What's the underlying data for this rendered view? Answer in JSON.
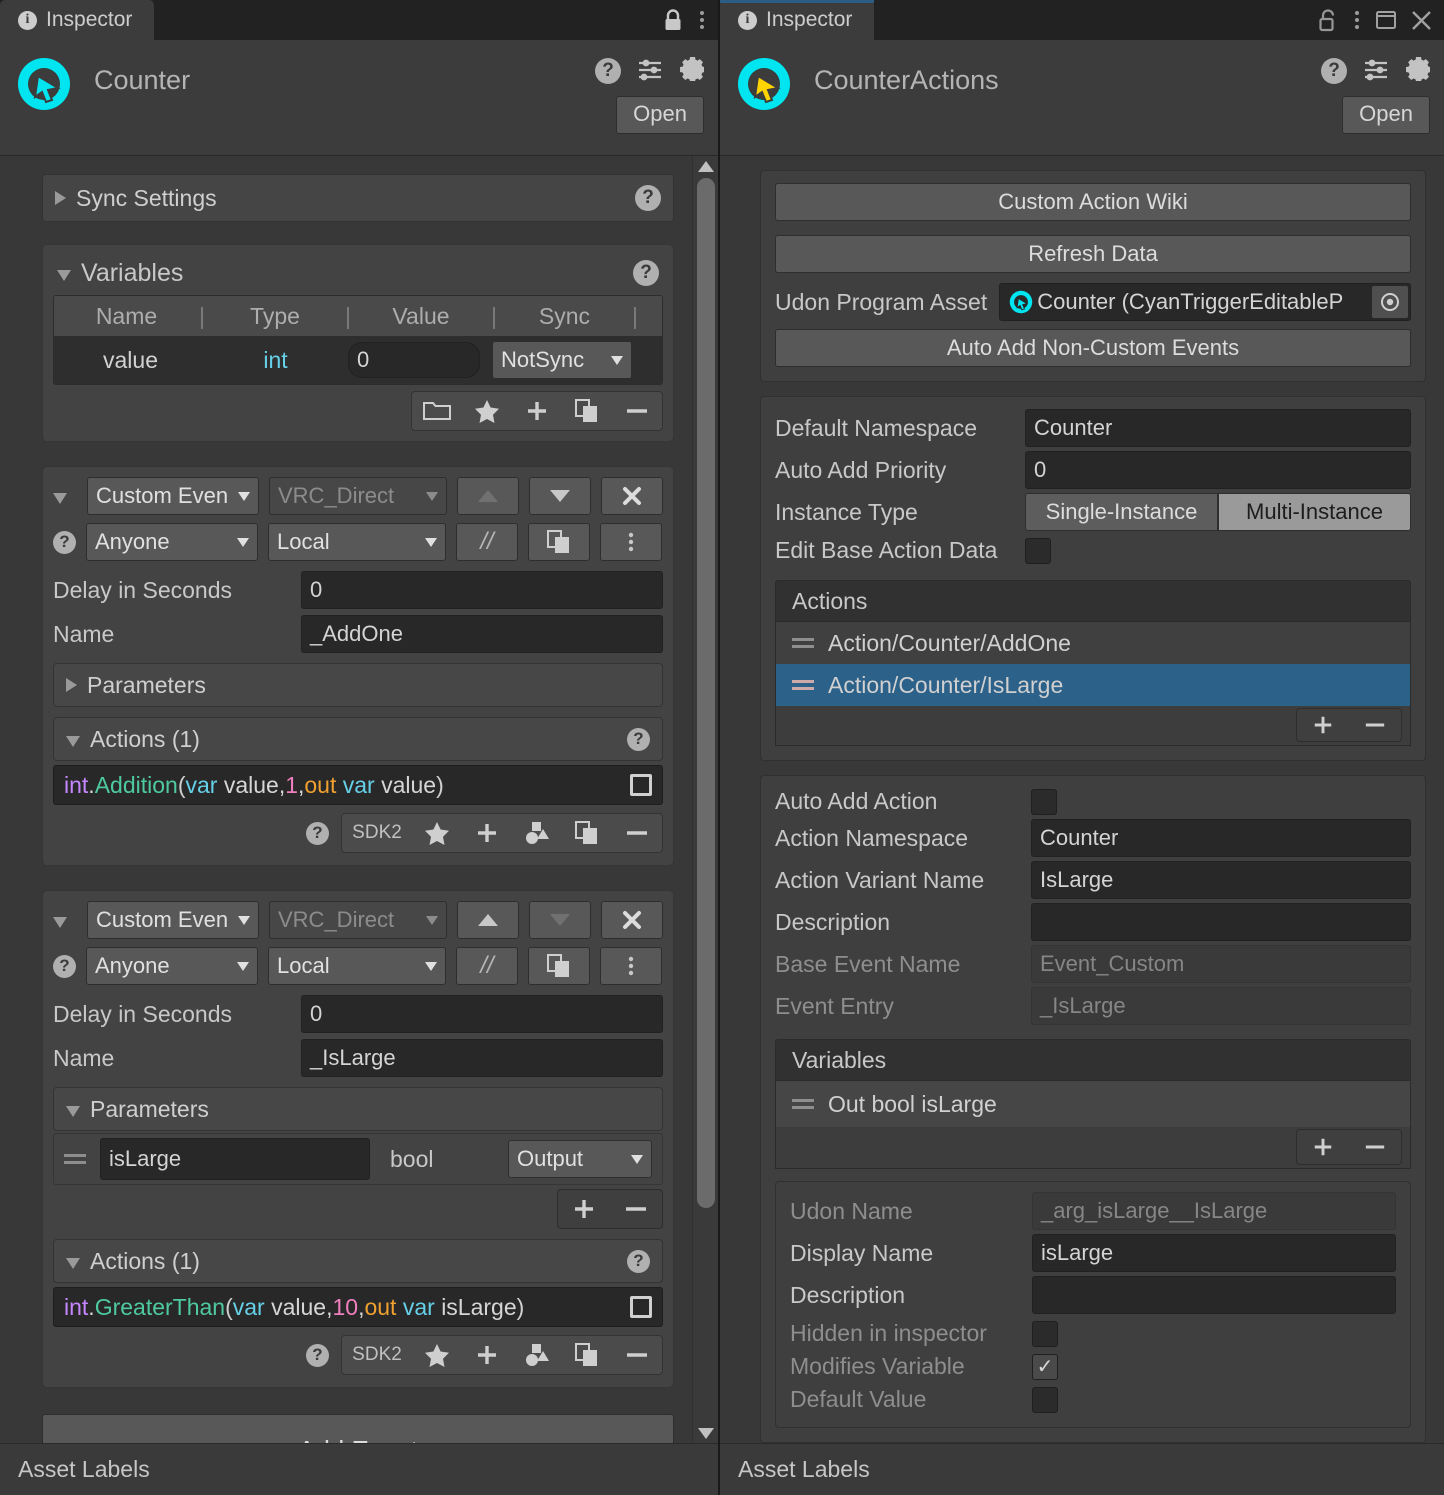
{
  "left_panel": {
    "tab_label": "Inspector",
    "lock_icon": "lock-closed-icon",
    "menu_icon": "kebab-menu-icon",
    "object_title": "Counter",
    "open_button": "Open",
    "header_icons": [
      "help-icon",
      "preset-icon",
      "gear-icon"
    ],
    "sync_settings": {
      "label": "Sync Settings"
    },
    "variables": {
      "label": "Variables",
      "columns": [
        "Name",
        "Type",
        "Value",
        "Sync"
      ],
      "rows": [
        {
          "name": "value",
          "type": "int",
          "value": "0",
          "sync": "NotSync"
        }
      ],
      "toolbar": [
        "folder-icon",
        "star-icon",
        "plus-icon",
        "duplicate-icon",
        "minus-icon"
      ]
    },
    "events": [
      {
        "type_dropdown": "Custom Even",
        "network_dropdown": "VRC_Direct",
        "up_enabled": false,
        "down_enabled": true,
        "close_label": "✖",
        "user_dropdown": "Anyone",
        "broadcast_dropdown": "Local",
        "comment_label": "//",
        "delay_label": "Delay in Seconds",
        "delay_value": "0",
        "name_label": "Name",
        "name_value": "_AddOne",
        "parameters_label": "Parameters",
        "parameters_expanded": false,
        "parameters": [],
        "actions_label": "Actions (1)",
        "actions": [
          {
            "type": "int",
            "dot": ".",
            "fn": "Addition",
            "open": "(",
            "kw1": "var",
            "arg1": "value",
            "comma1": ", ",
            "num": "1",
            "comma2": ", ",
            "out": "out",
            "kw2": "var",
            "arg2": "value",
            "close": ")"
          }
        ],
        "action_toolbar": {
          "sdk": "SDK2",
          "icons": [
            "star-icon",
            "plus-icon",
            "shapes-icon",
            "duplicate-icon",
            "minus-icon"
          ]
        }
      },
      {
        "type_dropdown": "Custom Even",
        "network_dropdown": "VRC_Direct",
        "up_enabled": true,
        "down_enabled": false,
        "close_label": "✖",
        "user_dropdown": "Anyone",
        "broadcast_dropdown": "Local",
        "comment_label": "//",
        "delay_label": "Delay in Seconds",
        "delay_value": "0",
        "name_label": "Name",
        "name_value": "_IsLarge",
        "parameters_label": "Parameters",
        "parameters_expanded": true,
        "parameters": [
          {
            "name": "isLarge",
            "type": "bool",
            "direction": "Output"
          }
        ],
        "actions_label": "Actions (1)",
        "actions": [
          {
            "type": "int",
            "dot": ".",
            "fn": "GreaterThan",
            "open": "(",
            "kw1": "var",
            "arg1": "value",
            "comma1": ", ",
            "num": "10",
            "comma2": ", ",
            "out": "out",
            "kw2": "var",
            "arg2": "isLarge",
            "close": ")"
          }
        ],
        "action_toolbar": {
          "sdk": "SDK2",
          "icons": [
            "star-icon",
            "plus-icon",
            "shapes-icon",
            "duplicate-icon",
            "minus-icon"
          ]
        }
      }
    ],
    "add_event_button": "Add Event",
    "footer_label": "Asset Labels"
  },
  "right_panel": {
    "tab_label": "Inspector",
    "window_icons": [
      "lock-open-icon",
      "kebab-menu-icon",
      "maximize-icon",
      "close-icon"
    ],
    "object_title": "CounterActions",
    "open_button": "Open",
    "header_icons": [
      "help-icon",
      "preset-icon",
      "gear-icon"
    ],
    "buttons": {
      "wiki": "Custom Action Wiki",
      "refresh": "Refresh Data",
      "auto_add_events": "Auto Add Non-Custom Events"
    },
    "udon_program_asset": {
      "label": "Udon Program Asset",
      "value": "Counter (CyanTriggerEditableP"
    },
    "settings": [
      {
        "label": "Default Namespace",
        "value": "Counter",
        "kind": "text"
      },
      {
        "label": "Auto Add Priority",
        "value": "0",
        "kind": "text"
      }
    ],
    "instance_type": {
      "label": "Instance Type",
      "options": [
        "Single-Instance",
        "Multi-Instance"
      ],
      "selected": "Multi-Instance"
    },
    "edit_base_action_data": {
      "label": "Edit Base Action Data",
      "checked": false
    },
    "actions_list": {
      "header": "Actions",
      "items": [
        {
          "label": "Action/Counter/AddOne",
          "selected": false
        },
        {
          "label": "Action/Counter/IsLarge",
          "selected": true
        }
      ],
      "plus": "+",
      "minus": "−"
    },
    "action_details": {
      "auto_add_action": {
        "label": "Auto Add Action",
        "checked": false
      },
      "action_namespace": {
        "label": "Action Namespace",
        "value": "Counter"
      },
      "action_variant_name": {
        "label": "Action Variant Name",
        "value": "IsLarge"
      },
      "description": {
        "label": "Description",
        "value": ""
      },
      "base_event_name": {
        "label": "Base Event Name",
        "value": "Event_Custom"
      },
      "event_entry": {
        "label": "Event Entry",
        "value": "_IsLarge"
      }
    },
    "variables": {
      "header": "Variables",
      "items": [
        {
          "label": "Out bool isLarge"
        }
      ],
      "plus": "+",
      "minus": "−",
      "details": {
        "udon_name": {
          "label": "Udon Name",
          "value": "_arg_isLarge__IsLarge"
        },
        "display_name": {
          "label": "Display Name",
          "value": "isLarge"
        },
        "description": {
          "label": "Description",
          "value": ""
        },
        "hidden_in_inspector": {
          "label": "Hidden in inspector",
          "checked": false
        },
        "modifies_variable": {
          "label": "Modifies Variable",
          "checked": true
        },
        "default_value": {
          "label": "Default Value",
          "checked": false
        }
      }
    },
    "footer_label": "Asset Labels"
  },
  "colors": {
    "accent_cyan": "#00e5f0",
    "selection_blue": "#2c6189",
    "type_purple": "#c586ff",
    "fn_green": "#4ec9a0",
    "var_cyan": "#66d0e8",
    "num_pink": "#ef7fbe",
    "out_orange": "#f0a030"
  }
}
